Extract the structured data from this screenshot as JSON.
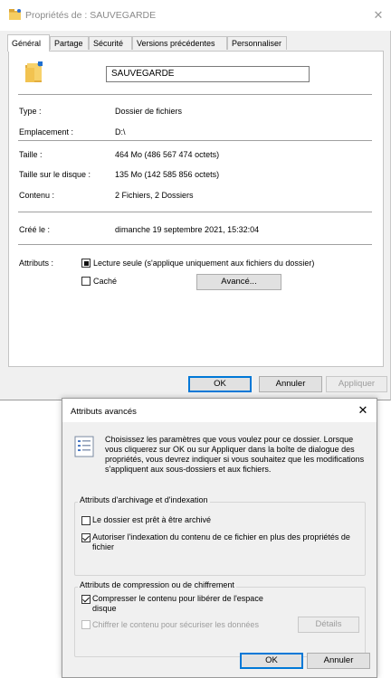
{
  "main": {
    "title": "Propriétés de : SAUVEGARDE",
    "tabs": [
      "Général",
      "Partage",
      "Sécurité",
      "Versions précédentes",
      "Personnaliser"
    ],
    "folder_name": "SAUVEGARDE",
    "rows": [
      {
        "label": "Type :",
        "value": "Dossier de fichiers"
      },
      {
        "label": "Emplacement :",
        "value": "D:\\"
      },
      {
        "label": "Taille :",
        "value": "464 Mo (486 567 474 octets)"
      },
      {
        "label": "Taille sur le disque :",
        "value": "135 Mo (142 585 856 octets)"
      },
      {
        "label": "Contenu :",
        "value": "2 Fichiers, 2 Dossiers"
      },
      {
        "label": "Créé le :",
        "value": "dimanche 19 septembre 2021, 15:32:04"
      }
    ],
    "attributes_label": "Attributs :",
    "readonly_label": "Lecture seule (s'applique uniquement aux fichiers du dossier)",
    "hidden_label": "Caché",
    "advanced_button": "Avancé...",
    "ok": "OK",
    "cancel": "Annuler",
    "apply": "Appliquer"
  },
  "advanced": {
    "title": "Attributs avancés",
    "description": "Choisissez les paramètres que vous voulez pour ce dossier. Lorsque vous cliquerez sur OK ou sur Appliquer dans la boîte de dialogue des propriétés, vous devrez indiquer si vous souhaitez que les modifications s'appliquent aux sous-dossiers et aux fichiers.",
    "archive_group": "Attributs d'archivage et d'indexation",
    "archive_label": "Le dossier est prêt à être archivé",
    "index_label": "Autoriser l'indexation du contenu de ce fichier en plus des propriétés de fichier",
    "compress_group": "Attributs de compression ou de chiffrement",
    "compress_label": "Compresser le contenu pour libérer de l'espace disque",
    "encrypt_label": "Chiffrer le contenu pour sécuriser les données",
    "details_button": "Détails",
    "ok": "OK",
    "cancel": "Annuler"
  }
}
